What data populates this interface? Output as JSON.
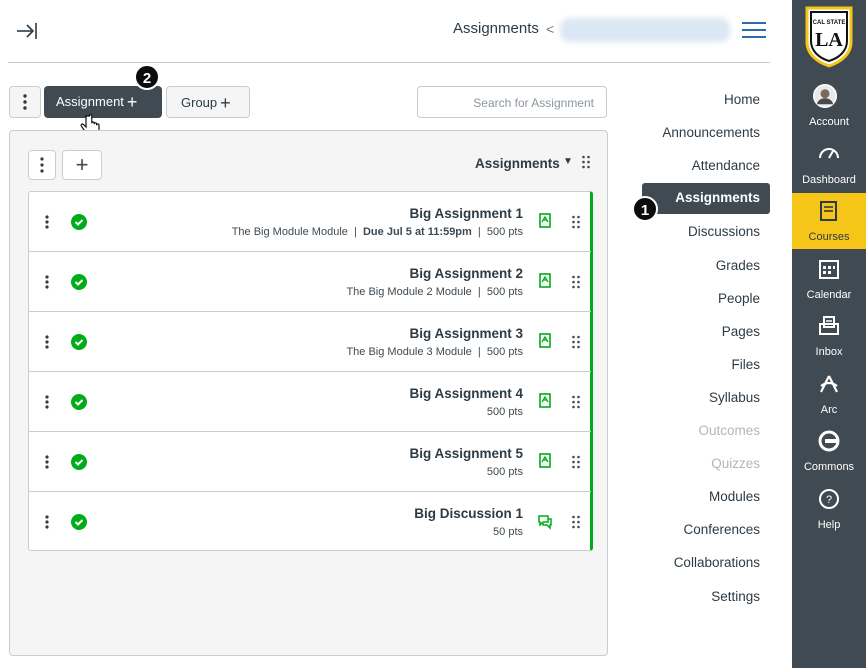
{
  "header": {
    "breadcrumb_current": "Assignments",
    "breadcrumb_separator": "<"
  },
  "global_nav": {
    "logo_lines": [
      "CAL STATE",
      "LA"
    ],
    "items": [
      {
        "label": "Account",
        "icon": "avatar"
      },
      {
        "label": "Dashboard",
        "icon": "dashboard-icon"
      },
      {
        "label": "Courses",
        "icon": "courses-icon"
      },
      {
        "label": "Calendar",
        "icon": "calendar-icon"
      },
      {
        "label": "Inbox",
        "icon": "inbox-icon"
      },
      {
        "label": "Arc",
        "icon": "arc-icon"
      },
      {
        "label": "Commons",
        "icon": "commons-icon"
      },
      {
        "label": "Help",
        "icon": "help-icon"
      }
    ],
    "active": "Courses"
  },
  "course_nav": {
    "items": [
      {
        "label": "Home",
        "muted": false
      },
      {
        "label": "Announcements",
        "muted": false
      },
      {
        "label": "Attendance",
        "muted": false
      },
      {
        "label": "Assignments",
        "muted": false
      },
      {
        "label": "Discussions",
        "muted": false
      },
      {
        "label": "Grades",
        "muted": false
      },
      {
        "label": "People",
        "muted": false
      },
      {
        "label": "Pages",
        "muted": false
      },
      {
        "label": "Files",
        "muted": false
      },
      {
        "label": "Syllabus",
        "muted": false
      },
      {
        "label": "Outcomes",
        "muted": true
      },
      {
        "label": "Quizzes",
        "muted": true
      },
      {
        "label": "Modules",
        "muted": false
      },
      {
        "label": "Conferences",
        "muted": false
      },
      {
        "label": "Collaborations",
        "muted": false
      },
      {
        "label": "Settings",
        "muted": false
      }
    ],
    "active": "Assignments"
  },
  "callouts": {
    "one": "1",
    "two": "2"
  },
  "toolbar": {
    "search_placeholder": "Search for Assignment",
    "group_label": "Group",
    "assignment_label": "Assignment",
    "plus": "+"
  },
  "group": {
    "title": "Assignments",
    "items": [
      {
        "title": "Big Assignment 1",
        "module": "The Big Module Module",
        "due": "Due Jul 5 at 11:59pm",
        "points": "500 pts",
        "type": "assignment"
      },
      {
        "title": "Big Assignment 2",
        "module": "The Big Module 2 Module",
        "due": "",
        "points": "500 pts",
        "type": "assignment"
      },
      {
        "title": "Big Assignment 3",
        "module": "The Big Module 3 Module",
        "due": "",
        "points": "500 pts",
        "type": "assignment"
      },
      {
        "title": "Big Assignment 4",
        "module": "",
        "due": "",
        "points": "500 pts",
        "type": "assignment"
      },
      {
        "title": "Big Assignment 5",
        "module": "",
        "due": "",
        "points": "500 pts",
        "type": "assignment"
      },
      {
        "title": "Big Discussion 1",
        "module": "",
        "due": "",
        "points": "50 pts",
        "type": "discussion"
      }
    ]
  },
  "colors": {
    "published_green": "#00ac18",
    "nav_bg": "#3f4a52",
    "active_yellow": "#f5c518",
    "link_blue": "#2b6cb0"
  }
}
